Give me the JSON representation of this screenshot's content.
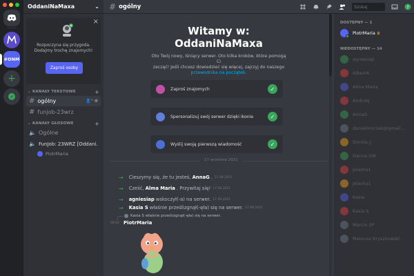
{
  "server": {
    "name": "OddaniNaMaxa",
    "icon_label": "#ONM"
  },
  "invite": {
    "line1": "Rozpoczyna się przygoda.",
    "line2": "Dodajmy trochę znajomych!",
    "button": "Zaproś osoby"
  },
  "categories": {
    "text": "KANAŁY TEKSTOWE",
    "voice": "KANAŁY GŁOSOWE"
  },
  "text_channels": [
    {
      "name": "ogólny"
    },
    {
      "name": "funjob-23wrz"
    }
  ],
  "voice_channels": [
    {
      "name": "Ogólne"
    },
    {
      "name": "FunJob: 23WRZ [Oddani..."
    }
  ],
  "voice_user": "PiotrMaria",
  "topbar": {
    "channel": "ogólny",
    "search_placeholder": "Szukaj"
  },
  "welcome": {
    "title_line1": "Witamy w:",
    "title_line2": "OddaniNaMaxa",
    "desc_line1": "Oto Twój nowy, lśniący serwer. Oto kilka kroków, które pomogą Ci",
    "desc_line2": "zacząć! Jeśli chcesz dowiedzieć się więcej, zajrzyj do naszego",
    "desc_link": "przewodnika na początek."
  },
  "tasks": [
    {
      "label": "Zaproś znajomych",
      "color": "#c052a5"
    },
    {
      "label": "Spersonalizuj swój serwer dzięki ikonie",
      "color": "#5f7fd8"
    },
    {
      "label": "Wyślij swoją pierwszą wiadomość",
      "color": "#4c6fd6"
    }
  ],
  "date_divider": "17 września 2021",
  "messages": [
    {
      "pre": "Cieszymy się, że tu jesteś,",
      "name": "AnnaG",
      "post": ".",
      "ts": "17.09.2021"
    },
    {
      "pre": "Cześć,",
      "name": "Alma Maria",
      "post": ". Przywitaj się!",
      "ts": "17.09.2021"
    },
    {
      "pre": "",
      "name": "agniesiap",
      "post": "wskoczył(-a) na serwer.",
      "ts": "17.09.2021"
    },
    {
      "pre": "",
      "name": "Kasia S",
      "post": "właśnie prześlizgnął(-ęła) się na serwer.",
      "ts": "17.09.2021"
    }
  ],
  "reply_ref": "Kasia S właśnie prześlizgnął(-ęła) się na serwer.",
  "sticker_msg": {
    "time": "08:02",
    "author": "PiotrMaria"
  },
  "members": {
    "online_header": "DOSTĘPNY — 1",
    "offline_header": "NIEDOSTĘPNY — 14",
    "online": [
      {
        "name": "PiotrMaria",
        "color": "#5865f2"
      }
    ],
    "offline": [
      {
        "name": "agniesiap",
        "color": "#3ba55c"
      },
      {
        "name": "AlbertA",
        "color": "#ed4245"
      },
      {
        "name": "Alma Maria",
        "color": "#5865f2"
      },
      {
        "name": "Andrzej",
        "color": "#ed4245"
      },
      {
        "name": "AnnaG",
        "color": "#3ba55c"
      },
      {
        "name": "danaklimczak@gmail.c...",
        "color": "#747f8d"
      },
      {
        "name": "Dorota J.",
        "color": "#faa61a"
      },
      {
        "name": "Hanna GM",
        "color": "#3ba55c"
      },
      {
        "name": "Jolanta1",
        "color": "#ed4245"
      },
      {
        "name": "Jolanta1",
        "color": "#faa61a"
      },
      {
        "name": "Kasia",
        "color": "#5865f2"
      },
      {
        "name": "Kasia S",
        "color": "#ed4245"
      },
      {
        "name": "Marcin SP",
        "color": "#747f8d"
      },
      {
        "name": "Mateusz Kryszkowski",
        "color": "#747f8d"
      }
    ]
  }
}
